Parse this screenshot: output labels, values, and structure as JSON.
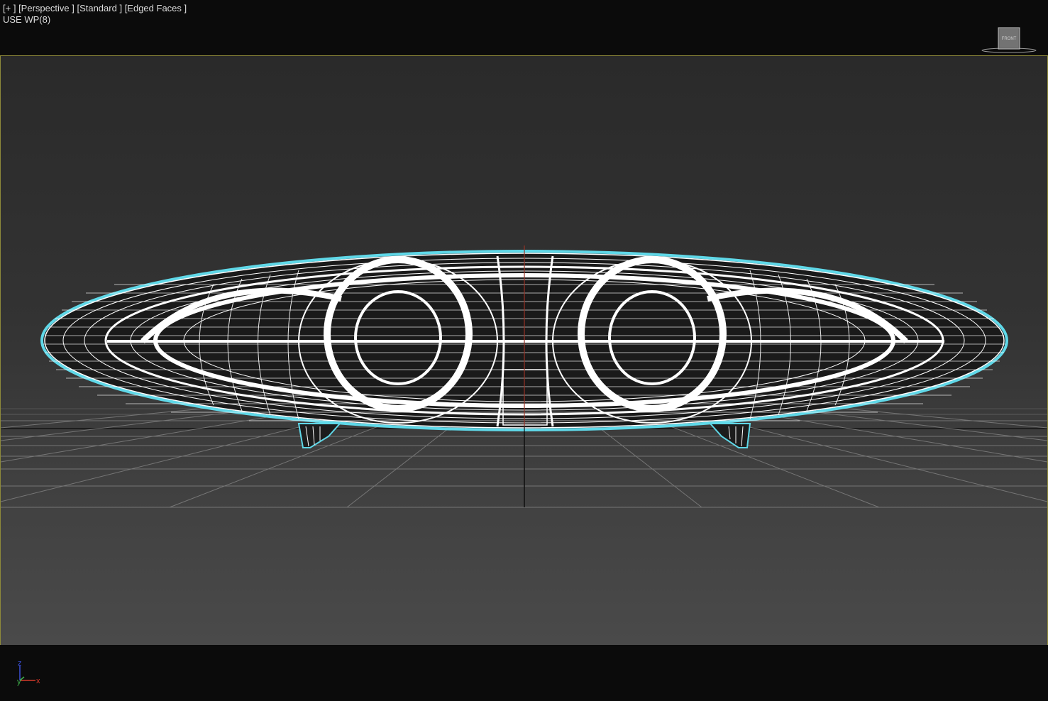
{
  "viewport": {
    "labels": {
      "plus": "[+ ]",
      "view": "[Perspective ]",
      "shading": "[Standard ]",
      "edges": "[Edged Faces ]"
    },
    "sub_label": "USE WP(8)",
    "viewcube_face": "FRONT",
    "axis_labels": {
      "z": "z",
      "y": "y",
      "x": "x"
    },
    "colors": {
      "border": "#8e8a3a",
      "selection_outline": "#5fd8e8",
      "wire": "#ffffff",
      "grid": "#8a8a8a"
    }
  }
}
